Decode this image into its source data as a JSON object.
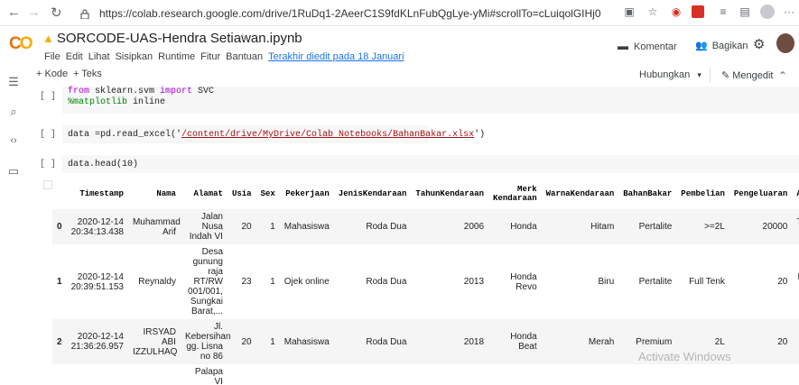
{
  "browser": {
    "back": "←",
    "forward": "→",
    "reload": "↻",
    "lock": "🔒",
    "url": "https://colab.research.google.com/drive/1RuDq1-2AeerC1S9fdKLnFubQgLye-yMi#scrollTo=cLuiqolGIHj0"
  },
  "header": {
    "logo": "CO",
    "title": "SORCODE-UAS-Hendra Setiawan.ipynb",
    "star": "☆",
    "menu": [
      "File",
      "Edit",
      "Lihat",
      "Sisipkan",
      "Runtime",
      "Fitur",
      "Bantuan"
    ],
    "last_edit": "Terakhir diedit pada 18 Januari",
    "komentar": "Komentar",
    "bagikan": "Bagikan"
  },
  "toolbar": {
    "add_code": "+ Kode",
    "add_text": "+ Teks",
    "connect": "Hubungkan",
    "editing": "Mengedit"
  },
  "cells": [
    {
      "bracket": "[ ]",
      "line1_kw1": "from",
      "line1_mid": " sklearn.svm ",
      "line1_kw2": "import",
      "line1_end": " SVC",
      "line2_magic": "%matplotlib",
      "line2_end": " inline"
    },
    {
      "bracket": "[ ]",
      "pre": "data =pd.read_excel('",
      "path": "/content/drive/MyDrive/Colab Notebooks/BahanBakar.xlsx",
      "post": "')"
    },
    {
      "bracket": "[ ]",
      "code": "data.head(10)"
    }
  ],
  "table": {
    "columns": [
      "Timestamp",
      "Nama",
      "Alamat",
      "Usia",
      "Sex",
      "Pekerjaan",
      "JenisKendaraan",
      "TahunKendaraan",
      "Merk Kendaraan",
      "WarnaKendaraan",
      "BahanBakar",
      "Pembelian",
      "Pengeluaran",
      "Al"
    ],
    "rows": [
      {
        "index": "0",
        "cells": [
          "2020-12-14 20:34:13.438",
          "Muhammad Arif",
          "Jalan Nusa Indah VI",
          "20",
          "1",
          "Mahasiswa",
          "Roda Dua",
          "2006",
          "Honda",
          "Hitam",
          "Pertalite",
          ">=2L",
          "20000",
          "Tergan ad"
        ]
      },
      {
        "index": "1",
        "cells": [
          "2020-12-14 20:39:51.153",
          "Reynaldy",
          "Desa gunung raja RT/RW 001/001, Sungkai Barat,...",
          "23",
          "1",
          "Ojek online",
          "Roda Dua",
          "2013",
          "Honda Revo",
          "Biru",
          "Pertalite",
          "Full Tenk",
          "20",
          "Ka pre la"
        ]
      },
      {
        "index": "2",
        "cells": [
          "2020-12-14 21:36:26.957",
          "IRSYAD ABI IZZULHAQ",
          "Jl. Kebersihan gg. Lisna no 86",
          "20",
          "1",
          "Mahasiswa",
          "Roda Dua",
          "2018",
          "Honda Beat",
          "Merah",
          "Premium",
          "2L",
          "20",
          "Ka murah s kebut"
        ]
      },
      {
        "index": "",
        "cells": [
          "",
          "",
          "Palapa VI",
          "",
          "",
          "",
          "",
          "",
          "",
          "",
          "",
          "",
          "",
          ""
        ]
      }
    ]
  },
  "watermark": "Activate Windows",
  "colors": {
    "accent": "#1a73e8",
    "logo_orange": "#f9ab00",
    "logo_dark_orange": "#e8710a"
  }
}
